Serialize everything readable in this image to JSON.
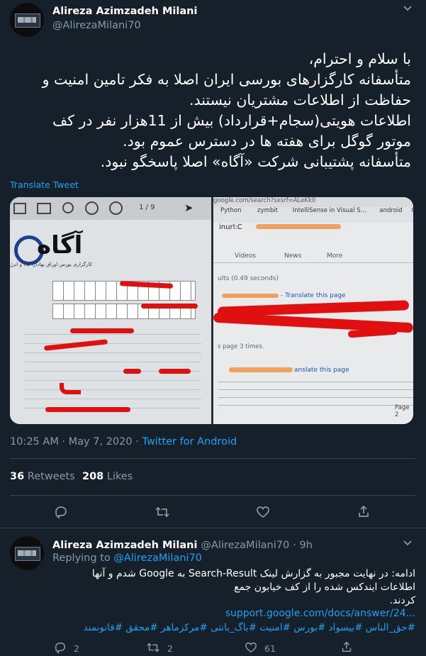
{
  "main_tweet": {
    "author_name": "Alireza Azimzadeh Milani",
    "author_handle": "@AlirezaMilani70",
    "text_lines": [
      "با سلام و احترام،",
      "متأسفانه کارگزارهای بورسی ایران اصلا به فکر تامین امنیت و",
      "حفاظت از اطلاعات مشتریان نیستند.",
      "اطلاعات هویتی(سجام+قرارداد) بیش از 11هزار نفر در کف",
      "موتور گوگل برای هفته ها در دسترس عموم بود.",
      "متأسفانه پشتیبانی شرکت «آگاه» اصلا پاسخگو نبود."
    ],
    "translate_label": "Translate Tweet",
    "timestamp": "10:25 AM · May 7, 2020 · ",
    "source": "Twitter for Android",
    "retweets_count": "36",
    "retweets_label": "Retweets",
    "likes_count": "208",
    "likes_label": "Likes"
  },
  "photo": {
    "pdf_toolbar_page": "1 / 9",
    "agah_logo_text": "آگاه",
    "agah_tagline": "کارگزاری بورس اوراق بهادار، کالا و انرژی",
    "browser_url": "google.com/search?sxsrf=ALeKk0",
    "bookmarks": [
      "Python",
      "zymbit",
      "IntelliSense in Visual S...",
      "android",
      "CV"
    ],
    "search_query": "inurl:C",
    "tabs": [
      "Videos",
      "News",
      "More"
    ],
    "results_count": "ults (0.49 seconds)",
    "translate_1": "- Translate this page",
    "visited": "s page 3 times.",
    "translate_2": "anslate this page",
    "page_tag": "Page 2"
  },
  "reply_tweet": {
    "author_name": "Alireza Azimzadeh Milani",
    "author_handle": "@AlirezaMilani70",
    "time": "· 9h",
    "replying_prefix": "Replying to ",
    "replying_handle": "@AlirezaMilani70",
    "text_lines": [
      "ادامه: در نهایت مجبور به گزارش لینک Search-Result به Google شدم و آنها",
      "اطلاعات ایندکس شده را از کف خیابون جمع",
      "کردند."
    ],
    "link": "support.google.com/docs/answer/24...",
    "hashtags": "#حق_الناس #بیسواد #بورس #امنیت #باگ_بانتی #مرکزماهر #محقق #قانونمند",
    "reply_count": "2",
    "retweet_count": "2",
    "like_count": "61"
  },
  "icons": [
    "chevron-down-icon",
    "reply-icon",
    "retweet-icon",
    "like-icon",
    "share-icon"
  ],
  "colors": {
    "background": "#15202b",
    "link": "#1da1f2",
    "muted": "#8899a6",
    "divider": "#38444d"
  }
}
